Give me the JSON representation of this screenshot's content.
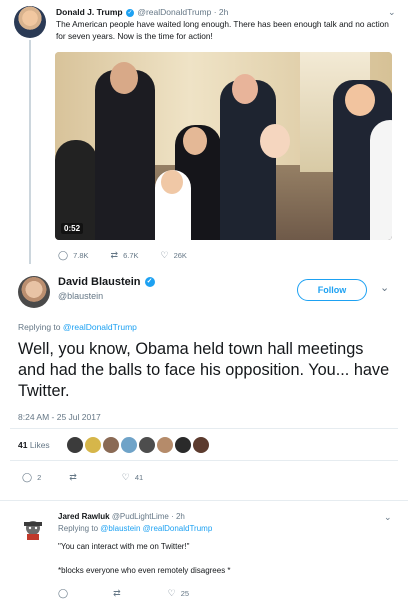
{
  "tweet1": {
    "name": "Donald J. Trump",
    "handle": "@realDonaldTrump",
    "time": "2h",
    "text": "The American people have waited long enough. There has been enough talk and no action for seven years. Now is the time for action!",
    "video_duration": "0:52",
    "replies": "7.8K",
    "retweets": "6.7K",
    "likes": "26K"
  },
  "tweet2": {
    "name": "David Blaustein",
    "handle": "@blaustein",
    "follow_label": "Follow",
    "replying_prefix": "Replying to",
    "replying_to": "@realDonaldTrump",
    "text": "Well, you know, Obama held town hall meetings and had the balls to face his opposition. You... have Twitter.",
    "timestamp": "8:24 AM - 25 Jul 2017",
    "likes_number": "41",
    "likes_label": "Likes",
    "replies": "2",
    "retweets": "",
    "likes": "41"
  },
  "tweet3": {
    "name": "Jared Rawluk",
    "handle": "@PudLightLime",
    "time": "2h",
    "replying_prefix": "Replying to",
    "replying_to_1": "@blaustein",
    "replying_to_2": "@realDonaldTrump",
    "text_line1": "\"You can interact with me on Twitter!\"",
    "text_line2": "*blocks everyone who even remotely disagrees *",
    "replies": "",
    "retweets": "",
    "likes": "25"
  },
  "icons": {
    "reply": "reply-icon",
    "retweet": "retweet-icon",
    "like": "heart-icon",
    "verified": "verified-badge-icon",
    "chevron": "chevron-down-icon"
  },
  "colors": {
    "accent": "#1da1f2",
    "muted": "#657786",
    "divider": "#e6ecf0"
  }
}
